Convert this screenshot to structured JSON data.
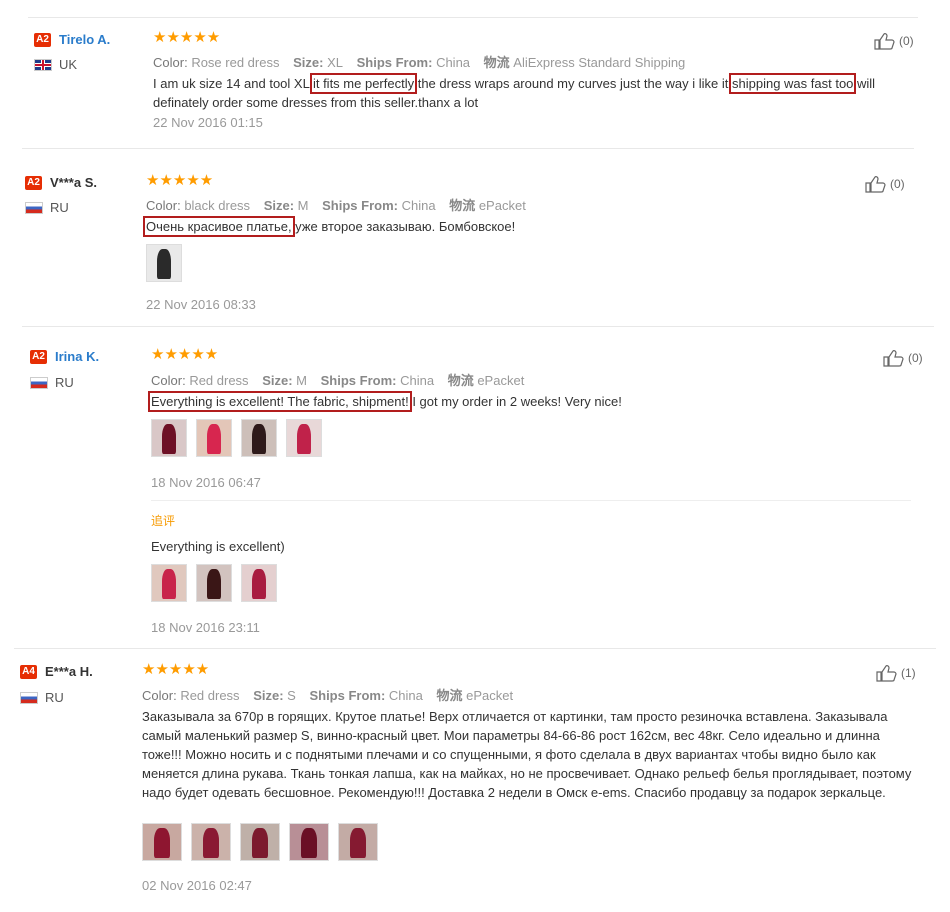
{
  "colors": {
    "accent_link": "#2a7ccb",
    "level_badge": "#e62e04",
    "star": "#ff9c00",
    "highlight_box": "#b21d1d",
    "additional_label": "#f79a00"
  },
  "labels": {
    "color": "Color:",
    "size": "Size:",
    "ships_from": "Ships From:",
    "logistics": "物流",
    "additional_feedback": "追评",
    "stars": "★★★★★"
  },
  "reviews": [
    {
      "level": "A2",
      "name": "Tirelo A.",
      "country": "UK",
      "flag": "uk-flag",
      "color": "Rose red dress",
      "size": "XL",
      "ships_from": "China",
      "shipping": "AliExpress Standard Shipping",
      "text_a": "I am uk size 14 and tool XL ",
      "hl_1": "it fits me perfectly",
      "text_b": " the dress wraps around my curves just the way i like it ",
      "hl_2": "shipping was fast too",
      "text_c": " will definately order some dresses from this seller.thanx a lot",
      "date": "22 Nov 2016 01:15",
      "helpful": "(0)"
    },
    {
      "level": "A2",
      "name": "V***a S.",
      "country": "RU",
      "flag": "ru-flag",
      "color": "black dress",
      "size": "M",
      "ships_from": "China",
      "shipping": "ePacket",
      "hl_1": "Очень красивое платье,",
      "text_a": " уже второе заказываю. Бомбовское!",
      "date": "22 Nov 2016 08:33",
      "helpful": "(0)"
    },
    {
      "level": "A2",
      "name": "Irina K.",
      "country": "RU",
      "flag": "ru-flag",
      "color": "Red dress",
      "size": "M",
      "ships_from": "China",
      "shipping": "ePacket",
      "hl_1": "Everything is excellent! The fabric, shipment!",
      "text_a": " I got my order in 2 weeks! Very nice!",
      "date": "18 Nov 2016 06:47",
      "helpful": "(0)",
      "additional_text": "Everything is excellent)",
      "additional_date": "18 Nov 2016 23:11"
    },
    {
      "level": "A4",
      "name": "E***a H.",
      "country": "RU",
      "flag": "ru-flag",
      "color": "Red dress",
      "size": "S",
      "ships_from": "China",
      "shipping": "ePacket",
      "text_a": "Заказывала за 670р в горящих. Крутое платье! Верх отличается от картинки, там просто резиночка вставлена. Заказывала самый маленький размер S, винно-красный цвет. Мои параметры 84-66-86 рост 162см, вес 48кг. Село идеально и длинна тоже!!! Можно носить и с поднятыми плечами и со спущенными, я фото сделала в двух вариантах чтобы видно было как меняется длина рукава. Ткань тонкая лапша, как на майках, но не просвечивает. Однако рельеф белья проглядывает, поэтому надо будет одевать бесшовное. Рекомендую!!! Доставка 2 недели в Омск е-ems. Спасибо продавцу за подарок зеркальце.",
      "date": "02 Nov 2016 02:47",
      "helpful": "(1)"
    }
  ]
}
